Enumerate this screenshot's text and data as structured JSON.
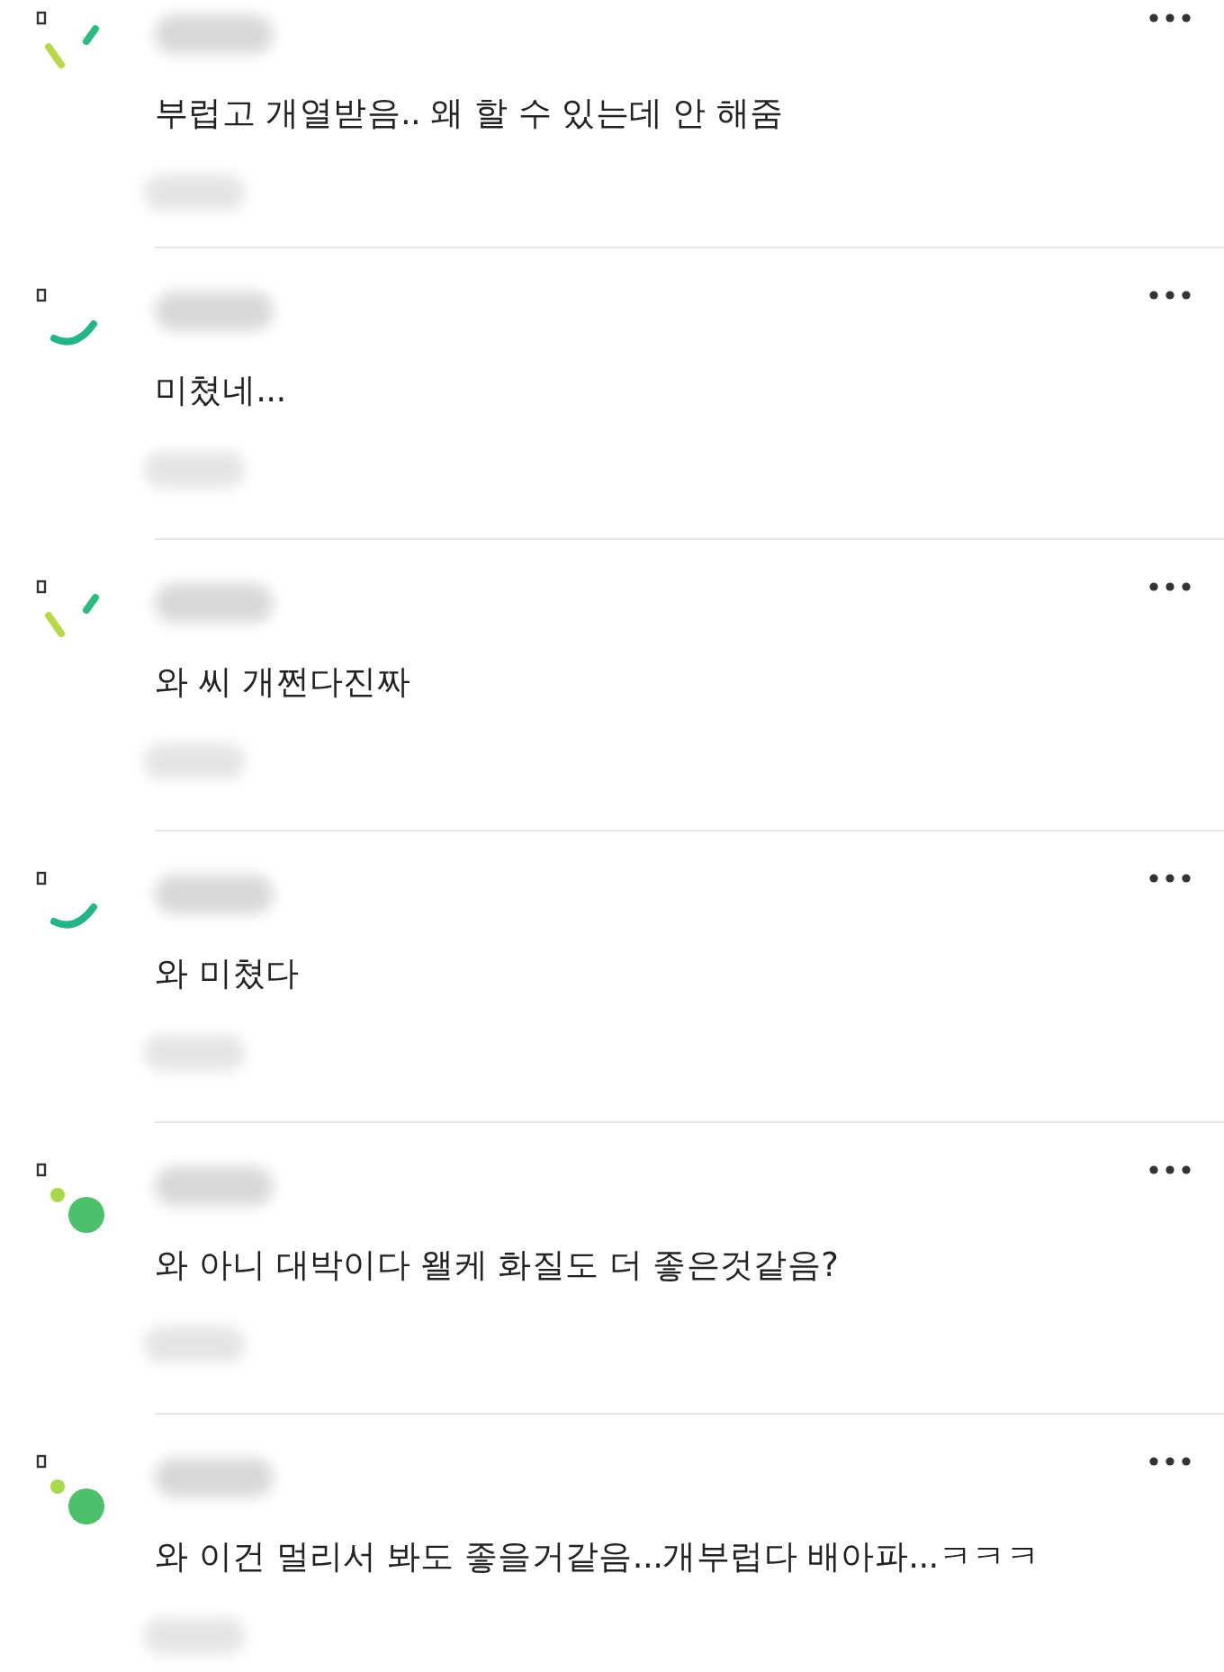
{
  "comments": [
    {
      "kind": "dash",
      "text": "부럽고 개열받음.. 왜 할 수 있는데 안 해줌"
    },
    {
      "kind": "arc",
      "text": "미쳤네..."
    },
    {
      "kind": "dash",
      "text": "와 씨 개쩐다진짜"
    },
    {
      "kind": "arc",
      "text": "와 미쳤다"
    },
    {
      "kind": "dots",
      "text": "와 아니 대박이다 왤케 화질도 더 좋은것같음?"
    },
    {
      "kind": "dots",
      "text": "와 이건 멀리서 봐도 좋을거같음...개부럽다 배아파...ㅋㅋㅋ"
    }
  ]
}
